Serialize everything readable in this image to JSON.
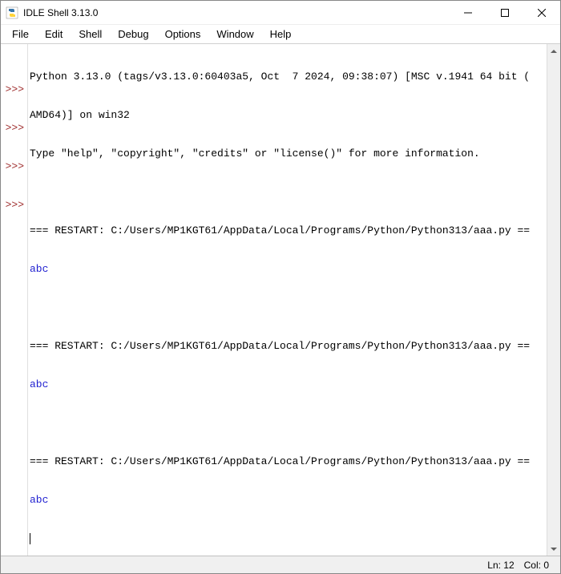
{
  "window": {
    "title": "IDLE Shell 3.13.0"
  },
  "menu": {
    "file": "File",
    "edit": "Edit",
    "shell": "Shell",
    "debug": "Debug",
    "options": "Options",
    "window": "Window",
    "help": "Help"
  },
  "prompt": ">>>",
  "lines": {
    "banner1": "Python 3.13.0 (tags/v3.13.0:60403a5, Oct  7 2024, 09:38:07) [MSC v.1941 64 bit (",
    "banner2": "AMD64)] on win32",
    "banner3": "Type \"help\", \"copyright\", \"credits\" or \"license()\" for more information.",
    "restart1": "=== RESTART: C:/Users/MP1KGT61/AppData/Local/Programs/Python/Python313/aaa.py ==",
    "output1": "abc",
    "restart2": "=== RESTART: C:/Users/MP1KGT61/AppData/Local/Programs/Python/Python313/aaa.py ==",
    "output2": "abc",
    "restart3": "=== RESTART: C:/Users/MP1KGT61/AppData/Local/Programs/Python/Python313/aaa.py ==",
    "output3": "abc"
  },
  "status": {
    "line": "Ln: 12",
    "col": "Col: 0"
  }
}
